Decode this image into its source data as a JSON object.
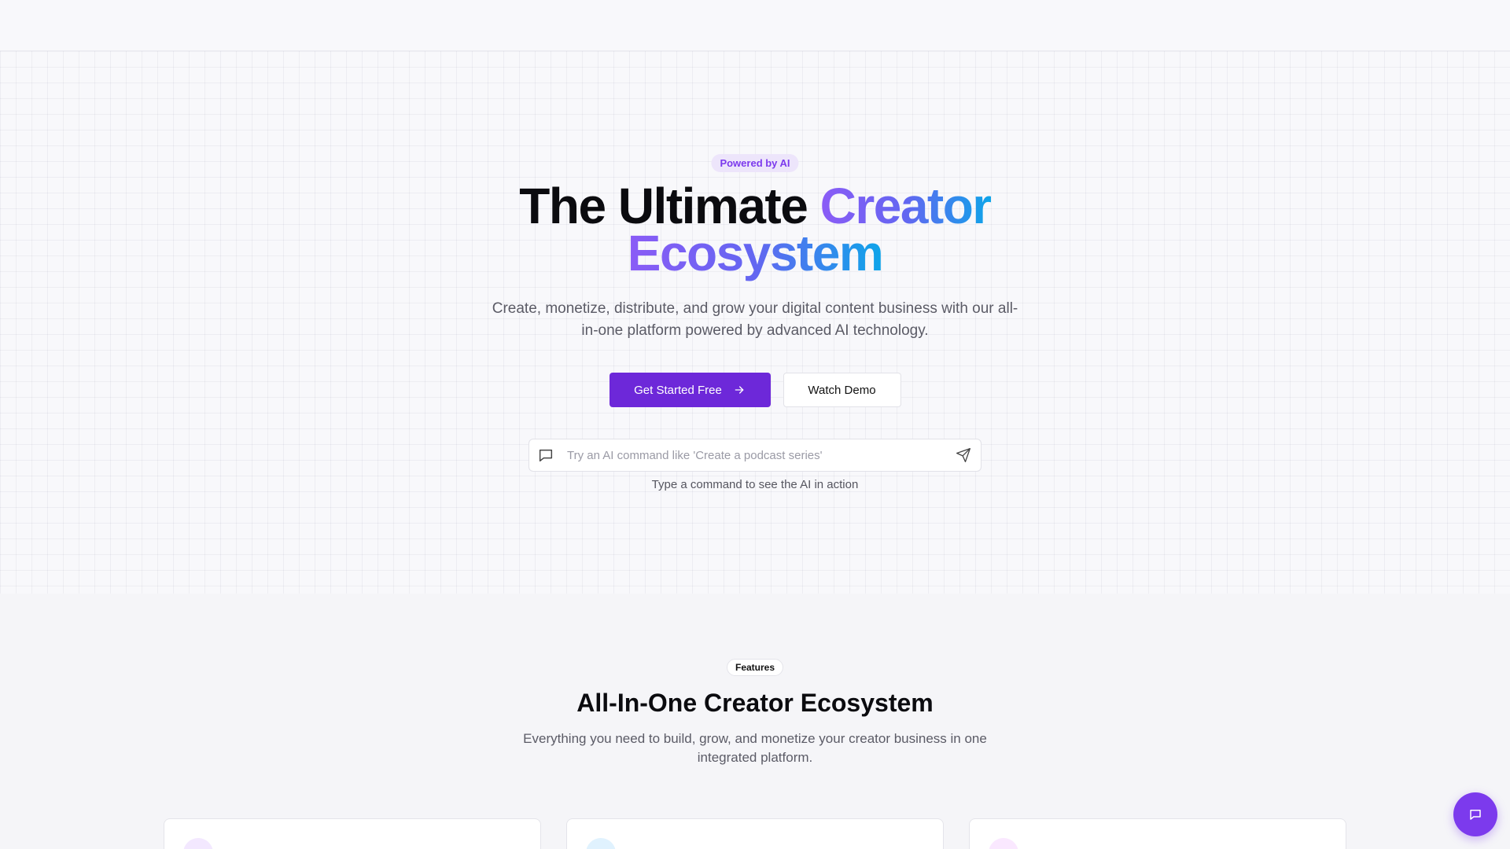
{
  "hero": {
    "badge": "Powered by AI",
    "title_plain": "The Ultimate ",
    "title_accent_1": "Creator",
    "title_accent_2": "Ecosystem",
    "subtitle": "Create, monetize, distribute, and grow your digital content business with our all-in-one platform powered by advanced AI technology.",
    "primary_button": "Get Started Free",
    "secondary_button": "Watch Demo",
    "command_placeholder": "Try an AI command like 'Create a podcast series'",
    "command_hint": "Type a command to see the AI in action"
  },
  "features": {
    "badge": "Features",
    "title": "All-In-One Creator Ecosystem",
    "subtitle": "Everything you need to build, grow, and monetize your creator business in one integrated platform."
  },
  "cards": [
    {
      "icon": "content-icon",
      "icon_color": "#f3e8ff"
    },
    {
      "icon": "globe-icon",
      "icon_color": "#e0f2fe"
    },
    {
      "icon": "sparkle-icon",
      "icon_color": "#fae8ff"
    }
  ],
  "colors": {
    "accent": "#6d28d9",
    "accent_light": "#7c3aed",
    "gradient_start": "#8b5cf6",
    "gradient_end": "#0ea5e9"
  },
  "fab": {
    "icon": "chat-icon"
  }
}
